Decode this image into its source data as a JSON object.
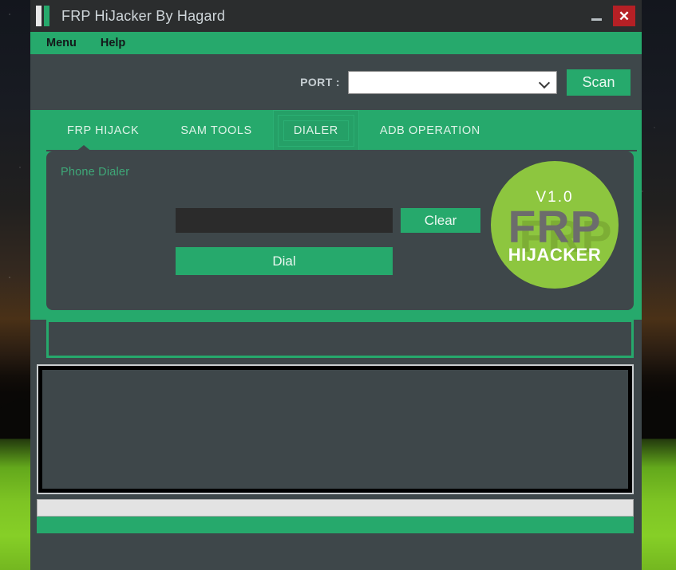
{
  "window": {
    "title": "FRP HiJacker By Hagard",
    "icon": "two-bars-icon",
    "minimize_label": "–",
    "close_label": "✕"
  },
  "menubar": {
    "items": [
      {
        "label": "Menu",
        "name": "menu-item-menu"
      },
      {
        "label": "Help",
        "name": "menu-item-help"
      }
    ]
  },
  "port": {
    "label": "PORT :",
    "value": "",
    "placeholder": "",
    "chevron": "chevron-down-icon",
    "scan_label": "Scan"
  },
  "tabs": [
    {
      "label": "FRP HIJACK",
      "selected": false
    },
    {
      "label": "SAM TOOLS",
      "selected": false
    },
    {
      "label": "DIALER",
      "selected": true
    },
    {
      "label": "ADB OPERATION",
      "selected": false
    }
  ],
  "dialer": {
    "panel_title": "Phone Dialer",
    "phone_value": "",
    "phone_placeholder": "",
    "clear_label": "Clear",
    "dial_label": "Dial"
  },
  "logo": {
    "version": "V1.0",
    "main": "FRP",
    "sub": "HIJACKER"
  },
  "status": {
    "text": ""
  },
  "log": {
    "text": ""
  },
  "progress": {
    "percent": 0,
    "text": ""
  },
  "colors": {
    "accent_green": "#26a96c",
    "panel_bg": "#3e474a",
    "titlebar_bg": "#2b2d2e",
    "close_red": "#b52025",
    "logo_green": "#8dc63f",
    "input_dark": "#2b2b2b"
  }
}
